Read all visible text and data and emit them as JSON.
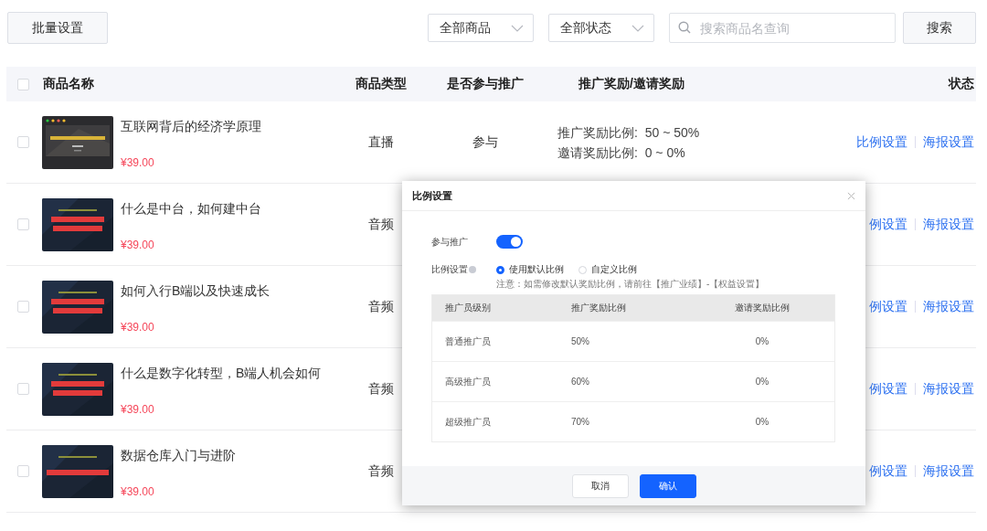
{
  "toolbar": {
    "batch_button": "批量设置",
    "filters": [
      {
        "label": "全部商品"
      },
      {
        "label": "全部状态"
      }
    ],
    "search": {
      "placeholder": "搜索商品名查询"
    },
    "search_button": "搜索"
  },
  "table": {
    "select_all": {
      "checked": false
    },
    "columns": [
      {
        "label": "商品名称"
      },
      {
        "label": "商品类型"
      },
      {
        "label": "是否参与推广"
      },
      {
        "label": "推广奖励/邀请奖励"
      },
      {
        "label": "状态"
      }
    ],
    "rows": [
      {
        "checked": false,
        "title": "互联网背后的经济学原理",
        "price": "¥39.00",
        "type": "直播",
        "promotion": "参与",
        "rewards": [
          "推广奖励比例:  50 ~ 50%",
          "邀请奖励比例:  0 ~ 0%"
        ],
        "actions": [
          "比例设置",
          "海报设置"
        ]
      },
      {
        "checked": false,
        "title": "什么是中台，如何建中台",
        "price": "¥39.00",
        "type": "音频",
        "actions": [
          "例设置",
          "海报设置"
        ]
      },
      {
        "checked": false,
        "title": "如何入行B端以及快速成长",
        "price": "¥39.00",
        "type": "音频",
        "actions": [
          "例设置",
          "海报设置"
        ]
      },
      {
        "checked": false,
        "title": "什么是数字化转型，B端人机会如何",
        "price": "¥39.00",
        "type": "音频",
        "actions": [
          "例设置",
          "海报设置"
        ]
      },
      {
        "checked": false,
        "title": "数据仓库入门与进阶",
        "price": "¥39.00",
        "type": "音频",
        "actions": [
          "例设置",
          "海报设置"
        ]
      }
    ]
  },
  "modal": {
    "title": "比例设置",
    "participate": {
      "label": "参与推广",
      "on": true
    },
    "ratio": {
      "label": "比例设置",
      "options": [
        {
          "label": "使用默认比例",
          "selected": true
        },
        {
          "label": "自定义比例",
          "selected": false
        }
      ],
      "note": "注意：如需修改默认奖励比例，请前往【推广业绩】-【权益设置】"
    },
    "table": {
      "columns": [
        "推广员级别",
        "推广奖励比例",
        "邀请奖励比例"
      ],
      "rows": [
        [
          "普通推广员",
          "50%",
          "0%"
        ],
        [
          "高级推广员",
          "60%",
          "0%"
        ],
        [
          "超级推广员",
          "70%",
          "0%"
        ]
      ]
    },
    "buttons": [
      {
        "label": "取消",
        "kind": "secondary"
      },
      {
        "label": "确认",
        "kind": "primary"
      }
    ]
  }
}
